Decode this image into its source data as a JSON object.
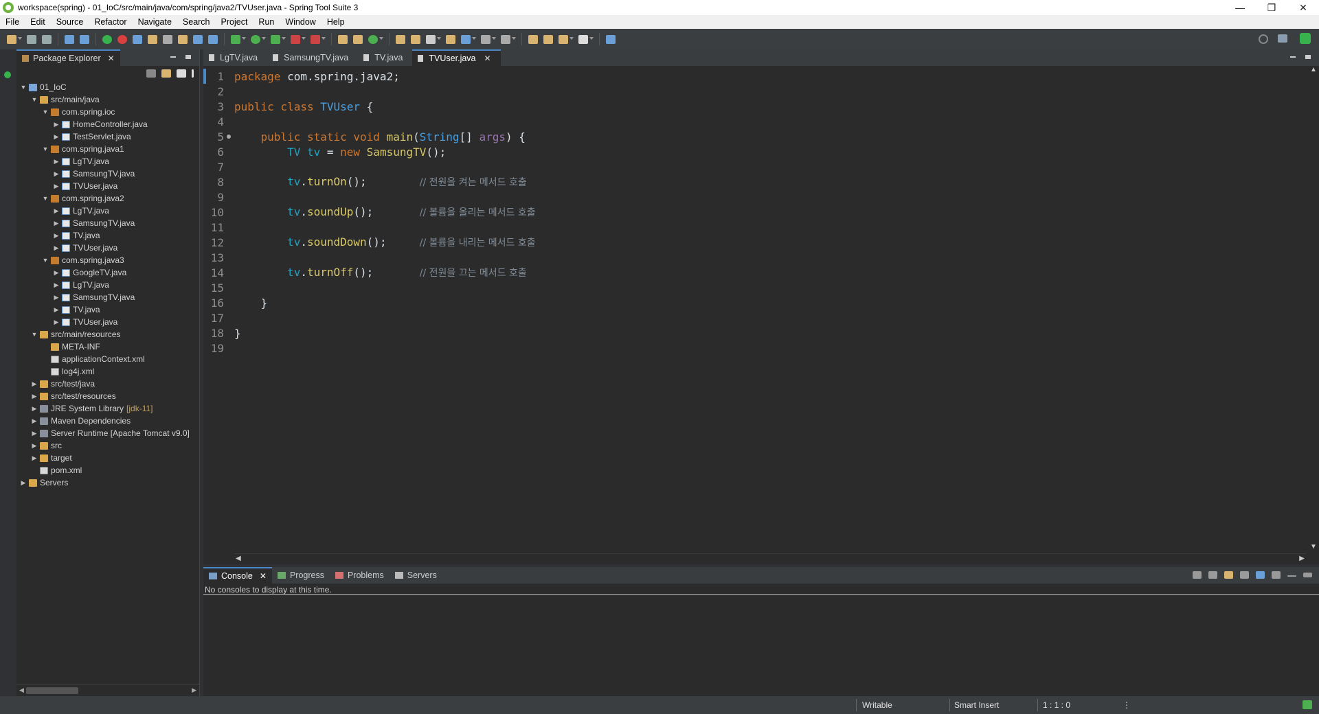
{
  "window": {
    "title": "workspace(spring) - 01_IoC/src/main/java/com/spring/java2/TVUser.java - Spring Tool Suite 3",
    "minimize": "—",
    "restore": "❐",
    "close": "✕"
  },
  "menu": [
    "File",
    "Edit",
    "Source",
    "Refactor",
    "Navigate",
    "Search",
    "Project",
    "Run",
    "Window",
    "Help"
  ],
  "package_explorer": {
    "tab_label": "Package Explorer",
    "tree": [
      {
        "label": "01_IoC",
        "icon": "project-icon",
        "indent": 0,
        "expanded": true
      },
      {
        "label": "src/main/java",
        "icon": "folder-icon",
        "indent": 1,
        "expanded": true
      },
      {
        "label": "com.spring.ioc",
        "icon": "package-icon",
        "indent": 2,
        "expanded": true
      },
      {
        "label": "HomeController.java",
        "icon": "java-file-icon",
        "indent": 3,
        "expanded": false
      },
      {
        "label": "TestServlet.java",
        "icon": "java-file-icon",
        "indent": 3,
        "expanded": false
      },
      {
        "label": "com.spring.java1",
        "icon": "package-icon",
        "indent": 2,
        "expanded": true
      },
      {
        "label": "LgTV.java",
        "icon": "java-file-icon",
        "indent": 3,
        "expanded": false
      },
      {
        "label": "SamsungTV.java",
        "icon": "java-file-icon",
        "indent": 3,
        "expanded": false
      },
      {
        "label": "TVUser.java",
        "icon": "java-file-icon",
        "indent": 3,
        "expanded": false
      },
      {
        "label": "com.spring.java2",
        "icon": "package-icon",
        "indent": 2,
        "expanded": true
      },
      {
        "label": "LgTV.java",
        "icon": "java-file-icon",
        "indent": 3,
        "expanded": false
      },
      {
        "label": "SamsungTV.java",
        "icon": "java-file-icon",
        "indent": 3,
        "expanded": false
      },
      {
        "label": "TV.java",
        "icon": "java-file-icon",
        "indent": 3,
        "expanded": false
      },
      {
        "label": "TVUser.java",
        "icon": "java-file-icon",
        "indent": 3,
        "expanded": false
      },
      {
        "label": "com.spring.java3",
        "icon": "package-icon",
        "indent": 2,
        "expanded": true
      },
      {
        "label": "GoogleTV.java",
        "icon": "java-file-icon",
        "indent": 3,
        "expanded": false
      },
      {
        "label": "LgTV.java",
        "icon": "java-file-icon",
        "indent": 3,
        "expanded": false
      },
      {
        "label": "SamsungTV.java",
        "icon": "java-file-icon",
        "indent": 3,
        "expanded": false
      },
      {
        "label": "TV.java",
        "icon": "java-file-icon",
        "indent": 3,
        "expanded": false
      },
      {
        "label": "TVUser.java",
        "icon": "java-file-icon",
        "indent": 3,
        "expanded": false
      },
      {
        "label": "src/main/resources",
        "icon": "folder-icon",
        "indent": 1,
        "expanded": true
      },
      {
        "label": "META-INF",
        "icon": "folder-icon",
        "indent": 2,
        "noarrow": true
      },
      {
        "label": "applicationContext.xml",
        "icon": "xml-file-icon",
        "indent": 2,
        "noarrow": true
      },
      {
        "label": "log4j.xml",
        "icon": "xml-file-icon",
        "indent": 2,
        "noarrow": true
      },
      {
        "label": "src/test/java",
        "icon": "folder-icon",
        "indent": 1,
        "expanded": false
      },
      {
        "label": "src/test/resources",
        "icon": "folder-icon",
        "indent": 1,
        "expanded": false
      },
      {
        "label": "JRE System Library",
        "suffix": "[jdk-11]",
        "icon": "library-icon",
        "indent": 1,
        "expanded": false
      },
      {
        "label": "Maven Dependencies",
        "icon": "library-icon",
        "indent": 1,
        "expanded": false
      },
      {
        "label": "Server Runtime [Apache Tomcat v9.0]",
        "icon": "library-icon",
        "indent": 1,
        "expanded": false
      },
      {
        "label": "src",
        "icon": "folder-icon",
        "indent": 1,
        "expanded": false
      },
      {
        "label": "target",
        "icon": "folder-icon",
        "indent": 1,
        "expanded": false
      },
      {
        "label": "pom.xml",
        "icon": "xml-file-icon",
        "indent": 1,
        "noarrow": true
      },
      {
        "label": "Servers",
        "icon": "folder-icon",
        "indent": 0,
        "expanded": false
      }
    ]
  },
  "editor": {
    "tabs": [
      {
        "label": "LgTV.java",
        "active": false
      },
      {
        "label": "SamsungTV.java",
        "active": false
      },
      {
        "label": "TV.java",
        "active": false
      },
      {
        "label": "TVUser.java",
        "active": true
      }
    ],
    "lines": [
      {
        "n": "1",
        "parts": [
          [
            "kw",
            "package"
          ],
          [
            "",
            " com.spring.java2;"
          ]
        ]
      },
      {
        "n": "2",
        "parts": []
      },
      {
        "n": "3",
        "parts": [
          [
            "kw",
            "public class "
          ],
          [
            "cls",
            "TVUser"
          ],
          [
            "",
            " {"
          ]
        ]
      },
      {
        "n": "4",
        "parts": []
      },
      {
        "n": "5",
        "parts": [
          [
            "",
            "    "
          ],
          [
            "kw",
            "public static void "
          ],
          [
            "fn",
            "main"
          ],
          [
            "",
            "("
          ],
          [
            "cls",
            "String"
          ],
          [
            "",
            "[] "
          ],
          [
            "str",
            "args"
          ],
          [
            "",
            ") {"
          ]
        ]
      },
      {
        "n": "6",
        "parts": [
          [
            "",
            "        "
          ],
          [
            "typ",
            "TV"
          ],
          [
            "",
            " "
          ],
          [
            "typ",
            "tv"
          ],
          [
            "",
            " = "
          ],
          [
            "kw",
            "new "
          ],
          [
            "fn",
            "SamsungTV"
          ],
          [
            "",
            "();"
          ]
        ]
      },
      {
        "n": "7",
        "parts": []
      },
      {
        "n": "8",
        "parts": [
          [
            "",
            "        "
          ],
          [
            "typ",
            "tv"
          ],
          [
            "",
            "."
          ],
          [
            "fn",
            "turnOn"
          ],
          [
            "",
            "();        "
          ],
          [
            "cm",
            "// 전원을 켜는 메서드 호출"
          ]
        ]
      },
      {
        "n": "9",
        "parts": []
      },
      {
        "n": "10",
        "parts": [
          [
            "",
            "        "
          ],
          [
            "typ",
            "tv"
          ],
          [
            "",
            "."
          ],
          [
            "fn",
            "soundUp"
          ],
          [
            "",
            "();       "
          ],
          [
            "cm",
            "// 볼륨을 올리는 메서드 호출"
          ]
        ]
      },
      {
        "n": "11",
        "parts": []
      },
      {
        "n": "12",
        "parts": [
          [
            "",
            "        "
          ],
          [
            "typ",
            "tv"
          ],
          [
            "",
            "."
          ],
          [
            "fn",
            "soundDown"
          ],
          [
            "",
            "();     "
          ],
          [
            "cm",
            "// 볼륨을 내리는 메서드 호출"
          ]
        ]
      },
      {
        "n": "13",
        "parts": []
      },
      {
        "n": "14",
        "parts": [
          [
            "",
            "        "
          ],
          [
            "typ",
            "tv"
          ],
          [
            "",
            "."
          ],
          [
            "fn",
            "turnOff"
          ],
          [
            "",
            "();       "
          ],
          [
            "cm",
            "// 전원을 끄는 메서드 호출"
          ]
        ]
      },
      {
        "n": "15",
        "parts": []
      },
      {
        "n": "16",
        "parts": [
          [
            "",
            "    }"
          ]
        ]
      },
      {
        "n": "17",
        "parts": []
      },
      {
        "n": "18",
        "parts": [
          [
            "",
            "}"
          ]
        ]
      },
      {
        "n": "19",
        "parts": []
      }
    ]
  },
  "console": {
    "tabs": [
      {
        "label": "Console",
        "active": true
      },
      {
        "label": "Progress",
        "active": false
      },
      {
        "label": "Problems",
        "active": false
      },
      {
        "label": "Servers",
        "active": false
      }
    ],
    "message": "No consoles to display at this time."
  },
  "status": {
    "writable": "Writable",
    "insert_mode": "Smart Insert",
    "position": "1 : 1 : 0"
  },
  "colors": {
    "accent": "#4a88c7",
    "keyword": "#cc7832",
    "class": "#4a9fe0"
  }
}
